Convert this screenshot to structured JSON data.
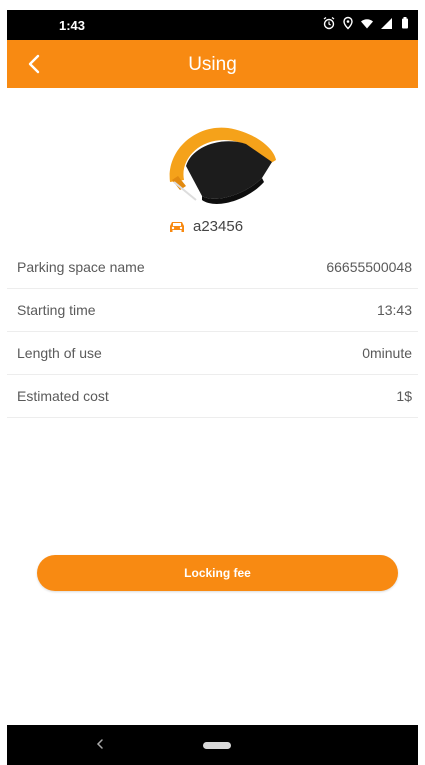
{
  "status_bar": {
    "time": "1:43",
    "icons": [
      "alarm-icon",
      "location-icon",
      "wifi-icon",
      "signal-icon",
      "battery-icon"
    ]
  },
  "header": {
    "title": "Using",
    "back_icon": "chevron-left-icon"
  },
  "device": {
    "plate_icon": "car-icon",
    "plate": "a23456"
  },
  "details": [
    {
      "label": "Parking space name",
      "value": "66655500048"
    },
    {
      "label": "Starting time",
      "value": "13:43"
    },
    {
      "label": "Length of use",
      "value": "0minute"
    },
    {
      "label": "Estimated cost",
      "value": "1$"
    }
  ],
  "action": {
    "label": "Locking fee"
  },
  "colors": {
    "accent": "#f88a12",
    "status_bar": "#000000",
    "nav_bar": "#000000"
  }
}
